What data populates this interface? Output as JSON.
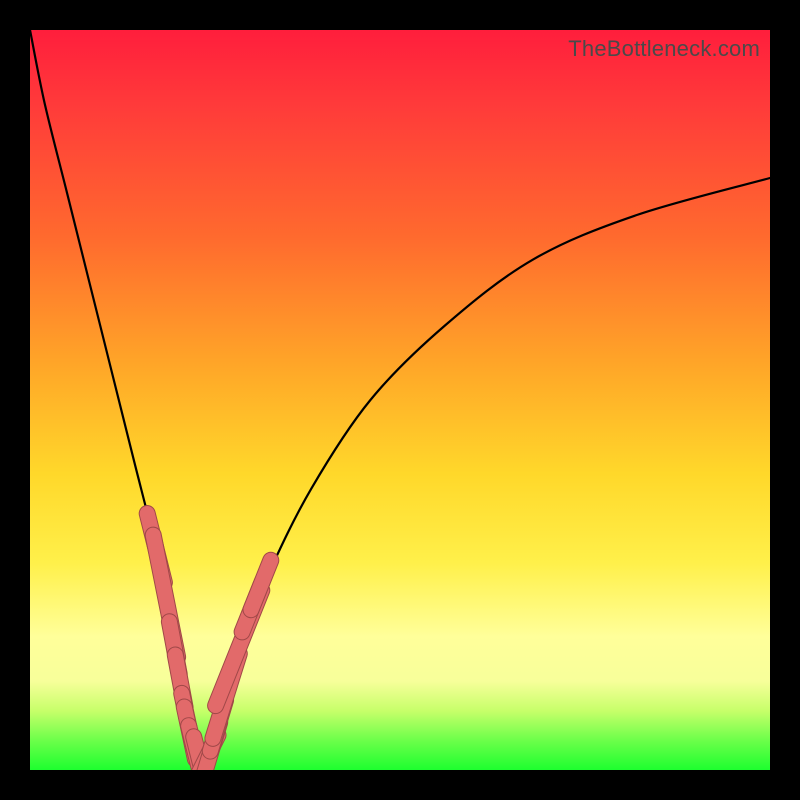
{
  "watermark": {
    "text": "TheBottleneck.com"
  },
  "colors": {
    "frame_bg": "#000000",
    "gradient_stops": [
      "#ff1e3c",
      "#ff3a3a",
      "#ff6a2e",
      "#ffa528",
      "#ffd82a",
      "#fff04a",
      "#ffff9a",
      "#f7ff9a",
      "#c7ff6a",
      "#6cff4a",
      "#1dff2f"
    ],
    "curve_stroke": "#000000",
    "marker_fill": "#e26a6a",
    "marker_stroke": "#a04848"
  },
  "chart_data": {
    "type": "line",
    "title": "",
    "xlabel": "",
    "ylabel": "",
    "xlim": [
      0,
      100
    ],
    "ylim": [
      0,
      100
    ],
    "note": "Axes are unlabeled in the original image; x/y are relative percent of plot area. Curve appears to be a bottleneck/V-shaped curve with minimum near x≈23, with salmon capsule markers clustered near the trough on both branches.",
    "series": [
      {
        "name": "bottleneck-curve",
        "x": [
          0,
          2,
          5,
          8,
          11,
          14,
          17,
          19,
          20.5,
          22,
          23,
          24,
          25.5,
          28,
          32,
          38,
          46,
          56,
          68,
          82,
          100
        ],
        "y": [
          100,
          90,
          78,
          66,
          54,
          42,
          30,
          20,
          12,
          5,
          1,
          3,
          8,
          16,
          26,
          38,
          50,
          60,
          69,
          75,
          80
        ]
      }
    ],
    "markers": {
      "description": "Salmon pill-shaped markers overlaid on the curve near the valley",
      "points_relative": [
        {
          "x": 17.0,
          "y": 30.0,
          "len": 2.0
        },
        {
          "x": 18.3,
          "y": 23.5,
          "len": 3.5
        },
        {
          "x": 19.5,
          "y": 16.5,
          "len": 1.5
        },
        {
          "x": 20.3,
          "y": 12.0,
          "len": 1.5
        },
        {
          "x": 21.0,
          "y": 8.0,
          "len": 1.0
        },
        {
          "x": 21.6,
          "y": 5.0,
          "len": 1.5
        },
        {
          "x": 22.3,
          "y": 2.5,
          "len": 1.5
        },
        {
          "x": 23.0,
          "y": 1.0,
          "len": 1.5
        },
        {
          "x": 23.8,
          "y": 1.5,
          "len": 1.5
        },
        {
          "x": 24.6,
          "y": 3.0,
          "len": 1.5
        },
        {
          "x": 25.4,
          "y": 6.0,
          "len": 1.5
        },
        {
          "x": 26.5,
          "y": 10.0,
          "len": 2.5
        },
        {
          "x": 28.2,
          "y": 16.5,
          "len": 3.5
        },
        {
          "x": 30.0,
          "y": 22.0,
          "len": 1.5
        },
        {
          "x": 31.2,
          "y": 25.0,
          "len": 1.5
        }
      ]
    }
  }
}
